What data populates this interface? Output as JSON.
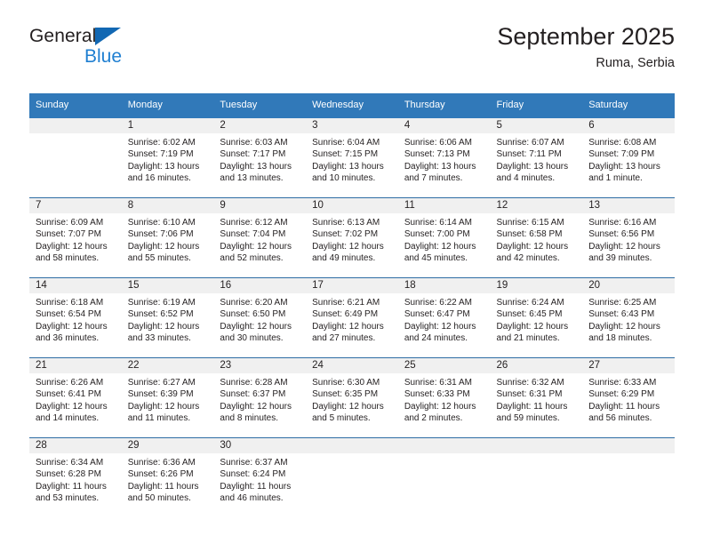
{
  "logo": {
    "word_one": "General",
    "word_two": "Blue",
    "triangle_color": "#1268b3",
    "blue_text_color": "#1f7fd1"
  },
  "header": {
    "title": "September 2025",
    "subtitle": "Ruma, Serbia"
  },
  "colors": {
    "header_row_bg": "#3179b9",
    "daynum_band_bg": "#f0f0f0",
    "row_divider": "#2e6da4",
    "text": "#231f20"
  },
  "weekday_headers": [
    "Sunday",
    "Monday",
    "Tuesday",
    "Wednesday",
    "Thursday",
    "Friday",
    "Saturday"
  ],
  "labels": {
    "sunrise_prefix": "Sunrise:",
    "sunset_prefix": "Sunset:",
    "daylight_prefix": "Daylight:"
  },
  "weeks": [
    [
      {
        "day": "",
        "sunrise": "",
        "sunset": "",
        "daylight_line1": "",
        "daylight_line2": ""
      },
      {
        "day": "1",
        "sunrise": "Sunrise: 6:02 AM",
        "sunset": "Sunset: 7:19 PM",
        "daylight_line1": "Daylight: 13 hours",
        "daylight_line2": "and 16 minutes."
      },
      {
        "day": "2",
        "sunrise": "Sunrise: 6:03 AM",
        "sunset": "Sunset: 7:17 PM",
        "daylight_line1": "Daylight: 13 hours",
        "daylight_line2": "and 13 minutes."
      },
      {
        "day": "3",
        "sunrise": "Sunrise: 6:04 AM",
        "sunset": "Sunset: 7:15 PM",
        "daylight_line1": "Daylight: 13 hours",
        "daylight_line2": "and 10 minutes."
      },
      {
        "day": "4",
        "sunrise": "Sunrise: 6:06 AM",
        "sunset": "Sunset: 7:13 PM",
        "daylight_line1": "Daylight: 13 hours",
        "daylight_line2": "and 7 minutes."
      },
      {
        "day": "5",
        "sunrise": "Sunrise: 6:07 AM",
        "sunset": "Sunset: 7:11 PM",
        "daylight_line1": "Daylight: 13 hours",
        "daylight_line2": "and 4 minutes."
      },
      {
        "day": "6",
        "sunrise": "Sunrise: 6:08 AM",
        "sunset": "Sunset: 7:09 PM",
        "daylight_line1": "Daylight: 13 hours",
        "daylight_line2": "and 1 minute."
      }
    ],
    [
      {
        "day": "7",
        "sunrise": "Sunrise: 6:09 AM",
        "sunset": "Sunset: 7:07 PM",
        "daylight_line1": "Daylight: 12 hours",
        "daylight_line2": "and 58 minutes."
      },
      {
        "day": "8",
        "sunrise": "Sunrise: 6:10 AM",
        "sunset": "Sunset: 7:06 PM",
        "daylight_line1": "Daylight: 12 hours",
        "daylight_line2": "and 55 minutes."
      },
      {
        "day": "9",
        "sunrise": "Sunrise: 6:12 AM",
        "sunset": "Sunset: 7:04 PM",
        "daylight_line1": "Daylight: 12 hours",
        "daylight_line2": "and 52 minutes."
      },
      {
        "day": "10",
        "sunrise": "Sunrise: 6:13 AM",
        "sunset": "Sunset: 7:02 PM",
        "daylight_line1": "Daylight: 12 hours",
        "daylight_line2": "and 49 minutes."
      },
      {
        "day": "11",
        "sunrise": "Sunrise: 6:14 AM",
        "sunset": "Sunset: 7:00 PM",
        "daylight_line1": "Daylight: 12 hours",
        "daylight_line2": "and 45 minutes."
      },
      {
        "day": "12",
        "sunrise": "Sunrise: 6:15 AM",
        "sunset": "Sunset: 6:58 PM",
        "daylight_line1": "Daylight: 12 hours",
        "daylight_line2": "and 42 minutes."
      },
      {
        "day": "13",
        "sunrise": "Sunrise: 6:16 AM",
        "sunset": "Sunset: 6:56 PM",
        "daylight_line1": "Daylight: 12 hours",
        "daylight_line2": "and 39 minutes."
      }
    ],
    [
      {
        "day": "14",
        "sunrise": "Sunrise: 6:18 AM",
        "sunset": "Sunset: 6:54 PM",
        "daylight_line1": "Daylight: 12 hours",
        "daylight_line2": "and 36 minutes."
      },
      {
        "day": "15",
        "sunrise": "Sunrise: 6:19 AM",
        "sunset": "Sunset: 6:52 PM",
        "daylight_line1": "Daylight: 12 hours",
        "daylight_line2": "and 33 minutes."
      },
      {
        "day": "16",
        "sunrise": "Sunrise: 6:20 AM",
        "sunset": "Sunset: 6:50 PM",
        "daylight_line1": "Daylight: 12 hours",
        "daylight_line2": "and 30 minutes."
      },
      {
        "day": "17",
        "sunrise": "Sunrise: 6:21 AM",
        "sunset": "Sunset: 6:49 PM",
        "daylight_line1": "Daylight: 12 hours",
        "daylight_line2": "and 27 minutes."
      },
      {
        "day": "18",
        "sunrise": "Sunrise: 6:22 AM",
        "sunset": "Sunset: 6:47 PM",
        "daylight_line1": "Daylight: 12 hours",
        "daylight_line2": "and 24 minutes."
      },
      {
        "day": "19",
        "sunrise": "Sunrise: 6:24 AM",
        "sunset": "Sunset: 6:45 PM",
        "daylight_line1": "Daylight: 12 hours",
        "daylight_line2": "and 21 minutes."
      },
      {
        "day": "20",
        "sunrise": "Sunrise: 6:25 AM",
        "sunset": "Sunset: 6:43 PM",
        "daylight_line1": "Daylight: 12 hours",
        "daylight_line2": "and 18 minutes."
      }
    ],
    [
      {
        "day": "21",
        "sunrise": "Sunrise: 6:26 AM",
        "sunset": "Sunset: 6:41 PM",
        "daylight_line1": "Daylight: 12 hours",
        "daylight_line2": "and 14 minutes."
      },
      {
        "day": "22",
        "sunrise": "Sunrise: 6:27 AM",
        "sunset": "Sunset: 6:39 PM",
        "daylight_line1": "Daylight: 12 hours",
        "daylight_line2": "and 11 minutes."
      },
      {
        "day": "23",
        "sunrise": "Sunrise: 6:28 AM",
        "sunset": "Sunset: 6:37 PM",
        "daylight_line1": "Daylight: 12 hours",
        "daylight_line2": "and 8 minutes."
      },
      {
        "day": "24",
        "sunrise": "Sunrise: 6:30 AM",
        "sunset": "Sunset: 6:35 PM",
        "daylight_line1": "Daylight: 12 hours",
        "daylight_line2": "and 5 minutes."
      },
      {
        "day": "25",
        "sunrise": "Sunrise: 6:31 AM",
        "sunset": "Sunset: 6:33 PM",
        "daylight_line1": "Daylight: 12 hours",
        "daylight_line2": "and 2 minutes."
      },
      {
        "day": "26",
        "sunrise": "Sunrise: 6:32 AM",
        "sunset": "Sunset: 6:31 PM",
        "daylight_line1": "Daylight: 11 hours",
        "daylight_line2": "and 59 minutes."
      },
      {
        "day": "27",
        "sunrise": "Sunrise: 6:33 AM",
        "sunset": "Sunset: 6:29 PM",
        "daylight_line1": "Daylight: 11 hours",
        "daylight_line2": "and 56 minutes."
      }
    ],
    [
      {
        "day": "28",
        "sunrise": "Sunrise: 6:34 AM",
        "sunset": "Sunset: 6:28 PM",
        "daylight_line1": "Daylight: 11 hours",
        "daylight_line2": "and 53 minutes."
      },
      {
        "day": "29",
        "sunrise": "Sunrise: 6:36 AM",
        "sunset": "Sunset: 6:26 PM",
        "daylight_line1": "Daylight: 11 hours",
        "daylight_line2": "and 50 minutes."
      },
      {
        "day": "30",
        "sunrise": "Sunrise: 6:37 AM",
        "sunset": "Sunset: 6:24 PM",
        "daylight_line1": "Daylight: 11 hours",
        "daylight_line2": "and 46 minutes."
      },
      {
        "day": "",
        "sunrise": "",
        "sunset": "",
        "daylight_line1": "",
        "daylight_line2": ""
      },
      {
        "day": "",
        "sunrise": "",
        "sunset": "",
        "daylight_line1": "",
        "daylight_line2": ""
      },
      {
        "day": "",
        "sunrise": "",
        "sunset": "",
        "daylight_line1": "",
        "daylight_line2": ""
      },
      {
        "day": "",
        "sunrise": "",
        "sunset": "",
        "daylight_line1": "",
        "daylight_line2": ""
      }
    ]
  ]
}
